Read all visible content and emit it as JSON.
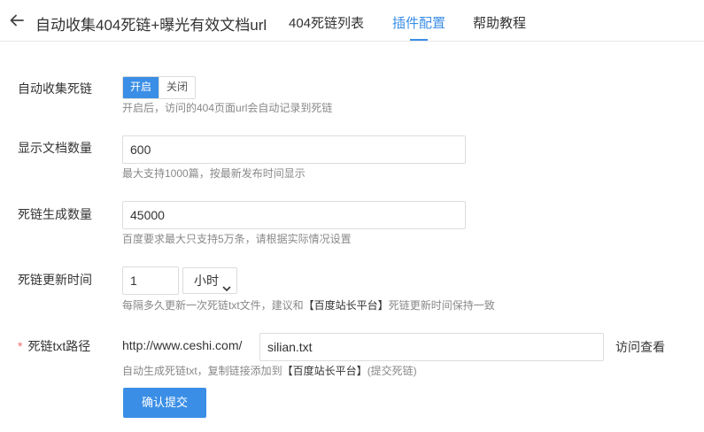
{
  "header": {
    "title": "自动收集404死链+曝光有效文档url",
    "tabs": [
      {
        "label": "404死链列表"
      },
      {
        "label": "插件配置"
      },
      {
        "label": "帮助教程"
      }
    ],
    "active_tab": "插件配置",
    "accent_color": "#3a8ee6"
  },
  "form": {
    "auto_collect": {
      "label": "自动收集死链",
      "on_label": "开启",
      "off_label": "关闭",
      "selected": "开启",
      "hint": "开启后，访问的404页面url会自动记录到死链"
    },
    "doc_count": {
      "label": "显示文档数量",
      "value": "600",
      "hint": "最大支持1000篇，按最新发布时间显示"
    },
    "deadlink_count": {
      "label": "死链生成数量",
      "value": "45000",
      "hint": "百度要求最大只支持5万条，请根据实际情况设置"
    },
    "update_interval": {
      "label": "死链更新时间",
      "value": "1",
      "unit": "小时",
      "hint_before": "每隔多久更新一次死链txt文件，建议和",
      "hint_link": "【百度站长平台】",
      "hint_after": "死链更新时间保持一致"
    },
    "txt_path": {
      "required_mark": "*",
      "label": "死链txt路径",
      "prefix": "http://www.ceshi.com/",
      "value": "silian.txt",
      "visit_label": "访问查看",
      "hint_before": "自动生成死链txt，复制链接添加到",
      "hint_link": "【百度站长平台】",
      "hint_after": "(提交死链)"
    },
    "submit_label": "确认提交"
  }
}
